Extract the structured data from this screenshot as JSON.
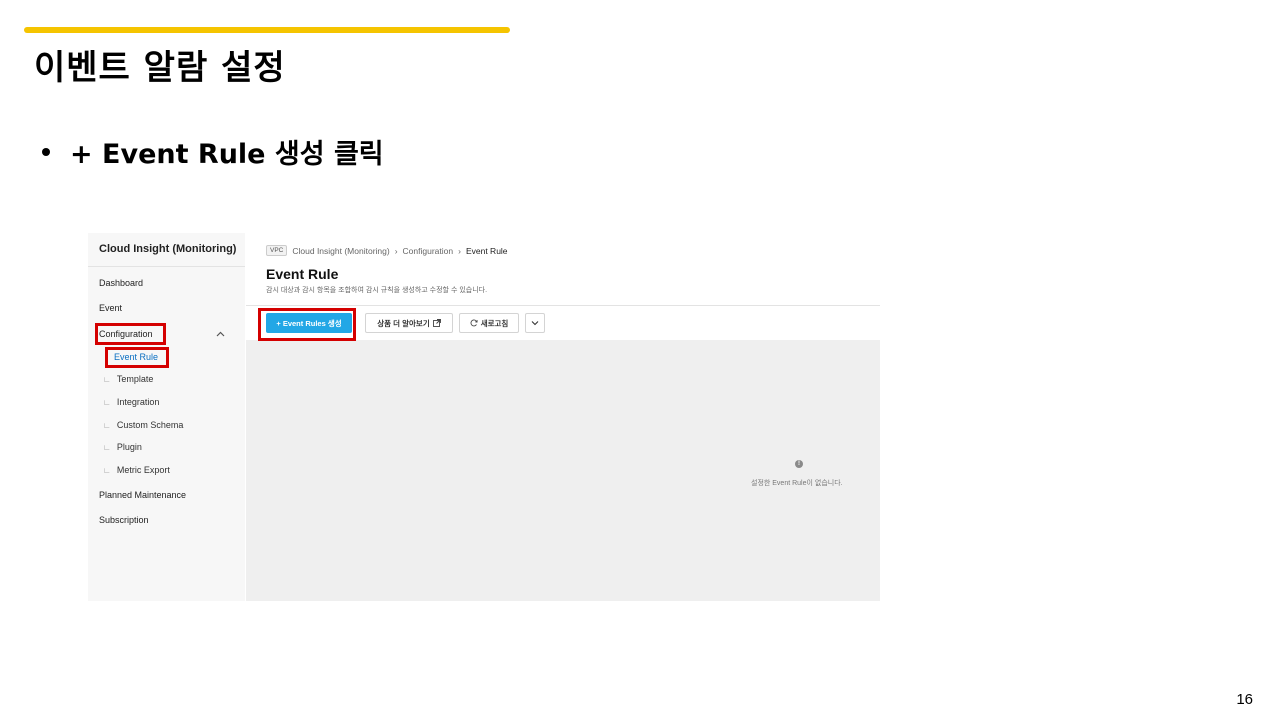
{
  "slide": {
    "title": "이벤트 알람 설정",
    "bullet": "+ Event Rule 생성 클릭",
    "page_number": "16",
    "accent_color": "#f5c400",
    "highlight_color": "#d40000"
  },
  "sidebar": {
    "title": "Cloud Insight (Monitoring)",
    "items": {
      "dashboard": "Dashboard",
      "event": "Event",
      "configuration": "Configuration",
      "event_rule": "Event Rule",
      "template": "Template",
      "integration": "Integration",
      "custom_schema": "Custom Schema",
      "plugin": "Plugin",
      "metric_export": "Metric Export",
      "planned_maintenance": "Planned Maintenance",
      "subscription": "Subscription"
    },
    "sub_marker": "∟"
  },
  "breadcrumb": {
    "badge": "VPC",
    "items": [
      "Cloud Insight (Monitoring)",
      "Configuration",
      "Event Rule"
    ],
    "separator": "›"
  },
  "page": {
    "title": "Event Rule",
    "description": "감시 대상과 감시 항목을 조합하여 감시 규칙을 생성하고 수정할 수 있습니다."
  },
  "toolbar": {
    "create_label": "+ Event Rules 생성",
    "learn_label": "상품 더 알아보기",
    "refresh_label": "새로고침",
    "primary_color": "#22a7e6"
  },
  "empty_state": {
    "icon_glyph": "!",
    "message": "설정한 Event Rule이 없습니다."
  }
}
